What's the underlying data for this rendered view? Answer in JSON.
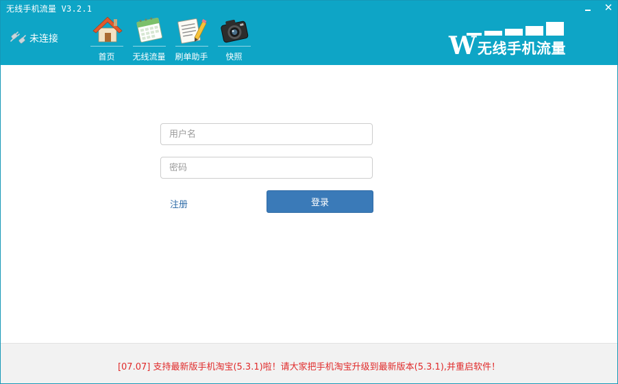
{
  "window": {
    "title": "无线手机流量 V3.2.1",
    "minimize": "minimize",
    "close_glyph": "✕"
  },
  "connection": {
    "status": "未连接",
    "icon": "plug-icon"
  },
  "nav": [
    {
      "label": "首页",
      "icon": "house-icon"
    },
    {
      "label": "无线流量",
      "icon": "calendar-icon"
    },
    {
      "label": "刷单助手",
      "icon": "notepad-pencil-icon"
    },
    {
      "label": "快照",
      "icon": "camera-icon"
    }
  ],
  "logo": {
    "w": "W",
    "text": "无线手机流量"
  },
  "login_form": {
    "username_placeholder": "用户名",
    "password_placeholder": "密码",
    "register_label": "注册",
    "login_label": "登录"
  },
  "footer": {
    "notice": "[07.07] 支持最新版手机淘宝(5.3.1)啦！请大家把手机淘宝升级到最新版本(5.3.1),并重启软件！"
  },
  "colors": {
    "header": "#0ea5c6",
    "button": "#3a7ab8",
    "notice": "#e02a2a",
    "link": "#2f6ca8"
  }
}
